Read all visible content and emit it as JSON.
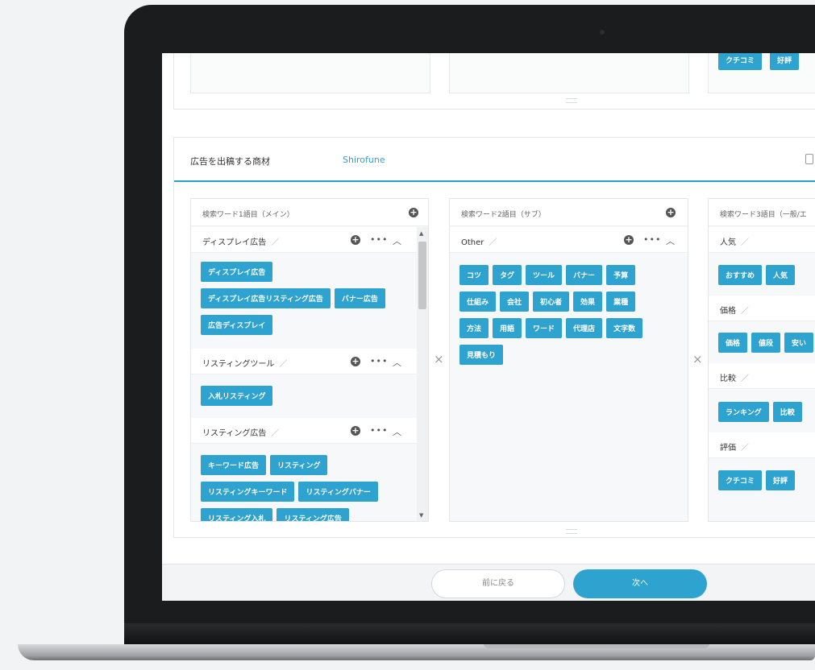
{
  "panel": {
    "label": "広告を出稿する商材",
    "value": "Shirofune"
  },
  "top_tags": [
    "クチコミ",
    "好評"
  ],
  "columns": [
    {
      "title": "検索ワード1語目（メイン）",
      "groups": [
        {
          "name": "ディスプレイ広告",
          "tags": [
            "ディスプレイ広告",
            "ディスプレイ広告リスティング広告",
            "バナー広告",
            "広告ディスプレイ"
          ]
        },
        {
          "name": "リスティングツール",
          "tags": [
            "入札リスティング"
          ]
        },
        {
          "name": "リスティング広告",
          "tags": [
            "キーワード広告",
            "リスティング",
            "リスティングキーワード",
            "リスティングバナー",
            "リスティング入札",
            "リスティング広告"
          ]
        }
      ]
    },
    {
      "title": "検索ワード2語目（サブ）",
      "groups": [
        {
          "name": "Other",
          "tags": [
            "コツ",
            "タグ",
            "ツール",
            "バナー",
            "予算",
            "仕組み",
            "会社",
            "初心者",
            "効果",
            "業種",
            "方法",
            "用語",
            "ワード",
            "代理店",
            "文字数",
            "見積もり"
          ]
        }
      ]
    },
    {
      "title": "検索ワード3語目（一般/エ",
      "groups": [
        {
          "name": "人気",
          "tags": [
            "おすすめ",
            "人気"
          ]
        },
        {
          "name": "価格",
          "tags": [
            "価格",
            "値段",
            "安い"
          ]
        },
        {
          "name": "比較",
          "tags": [
            "ランキング",
            "比較"
          ]
        },
        {
          "name": "評価",
          "tags": [
            "クチコミ",
            "好評"
          ]
        }
      ]
    }
  ],
  "icons": {
    "add": "plus-circle-icon",
    "edit": "pencil-icon",
    "more": "ellipsis-icon",
    "collapse": "chevron-up-icon",
    "cross": "times-icon",
    "copy": "clipboard-icon"
  },
  "footer": {
    "back_label": "前に戻る",
    "next_label": "次へ"
  },
  "colors": {
    "accent": "#2ea3cf",
    "bezel": "#1b1c1e"
  }
}
